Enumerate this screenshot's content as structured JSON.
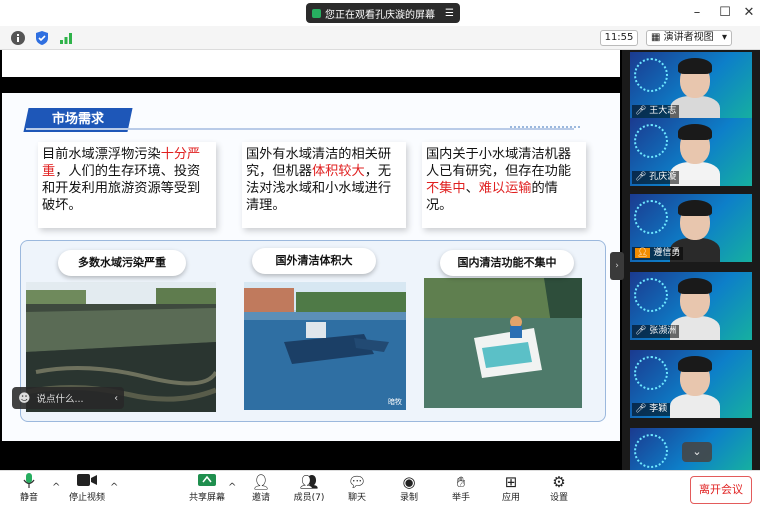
{
  "titlebar": {
    "share_notice": "您正在观看孔庆漩的屏幕",
    "window_controls": [
      "minimize",
      "maximize",
      "close"
    ]
  },
  "toprow": {
    "time": "11:55",
    "view_mode": "演讲者视图",
    "icons": [
      "info-icon",
      "shield-icon",
      "signal-icon"
    ]
  },
  "slide": {
    "heading": "市场需求",
    "boxes": [
      {
        "segments": [
          {
            "t": "目前水域漂浮物污染",
            "red": false
          },
          {
            "t": "十分严重",
            "red": true
          },
          {
            "t": "，人们的生存环境、投资和开发利用旅游资源等受到破坏。",
            "red": false
          }
        ]
      },
      {
        "segments": [
          {
            "t": "国外有水域清洁的相关研究，但机器",
            "red": false
          },
          {
            "t": "体积较大",
            "red": true
          },
          {
            "t": "，无法对浅水域和小水域进行清理。",
            "red": false
          }
        ]
      },
      {
        "segments": [
          {
            "t": "国内关于小水域清洁机器人已有研究，但存在功能",
            "red": false
          },
          {
            "t": "不集中",
            "red": true
          },
          {
            "t": "、",
            "red": false
          },
          {
            "t": "难以运输",
            "red": true
          },
          {
            "t": "的情况。",
            "red": false
          }
        ]
      }
    ],
    "captions": [
      "多数水域污染严重",
      "国外清洁体积大",
      "国内清洁功能不集中"
    ],
    "photo_watermark": "暗牧"
  },
  "chat": {
    "placeholder": "说点什么..."
  },
  "participants": [
    {
      "name": "王大志"
    },
    {
      "name": "孔庆漩"
    },
    {
      "name": "遵信勇"
    },
    {
      "name": "张濒洲"
    },
    {
      "name": "李颖"
    },
    {
      "name": ""
    }
  ],
  "toolbar": {
    "mute": "静音",
    "stop_video": "停止视频",
    "share": "共享屏幕",
    "invite": "邀请",
    "members": "成员(7)",
    "chat": "聊天",
    "record": "录制",
    "raise_hand": "举手",
    "apps": "应用",
    "settings": "设置",
    "leave": "离开会议"
  },
  "colors": {
    "accent": "#1e57b8",
    "highlight": "#e02020",
    "leave": "#e02020"
  }
}
